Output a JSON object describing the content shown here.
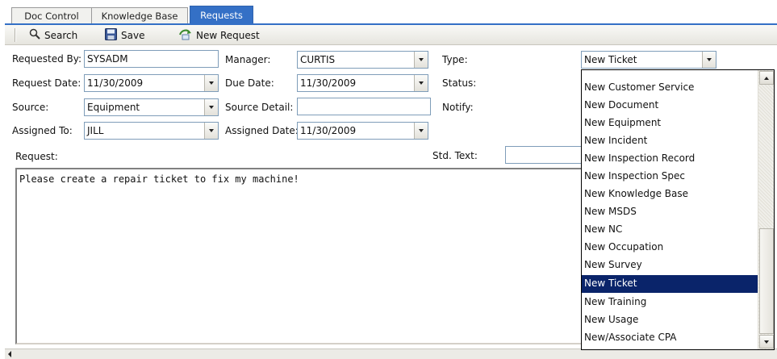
{
  "tabs": [
    {
      "label": "Doc Control",
      "active": false
    },
    {
      "label": "Knowledge Base",
      "active": false
    },
    {
      "label": "Requests",
      "active": true
    }
  ],
  "toolbar": {
    "search_label": "Search",
    "save_label": "Save",
    "new_request_label": "New Request"
  },
  "form": {
    "requested_by": {
      "label": "Requested By:",
      "value": "SYSADM"
    },
    "manager": {
      "label": "Manager:",
      "value": "CURTIS"
    },
    "type": {
      "label": "Type:",
      "value": "New Ticket"
    },
    "request_date": {
      "label": "Request Date:",
      "value": "11/30/2009"
    },
    "due_date": {
      "label": "Due Date:",
      "value": "11/30/2009"
    },
    "status": {
      "label": "Status:",
      "value": ""
    },
    "source": {
      "label": "Source:",
      "value": "Equipment"
    },
    "source_detail": {
      "label": "Source Detail:",
      "value": ""
    },
    "notify": {
      "label": "Notify:",
      "value": ""
    },
    "assigned_to": {
      "label": "Assigned To:",
      "value": "JILL"
    },
    "assigned_date": {
      "label": "Assigned Date:",
      "value": "11/30/2009"
    },
    "request": {
      "label": "Request:",
      "text": "Please create a repair ticket to fix my machine!"
    },
    "std_text": {
      "label": "Std. Text:",
      "value": ""
    }
  },
  "type_dropdown": {
    "items": [
      "New Customer Service",
      "New Document",
      "New Equipment",
      "New Incident",
      "New Inspection Record",
      "New Inspection Spec",
      "New Knowledge Base",
      "New MSDS",
      "New NC",
      "New Occupation",
      "New Survey",
      "New Ticket",
      "New Training",
      "New Usage",
      "New/Associate CPA"
    ],
    "selected": "New Ticket"
  },
  "colors": {
    "active_tab": "#3470c6",
    "selection": "#0a246a",
    "field_border": "#7f9db9"
  }
}
